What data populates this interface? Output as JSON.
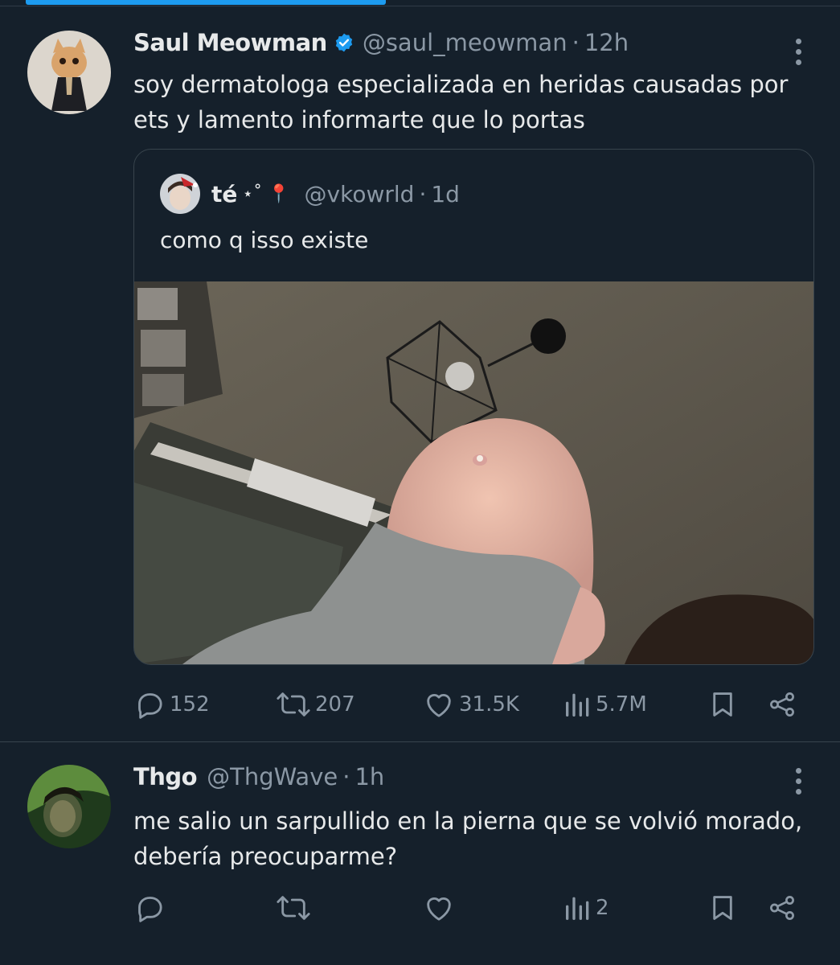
{
  "tweet": {
    "author_name": "Saul Meowman",
    "handle": "@saul_meowman",
    "separator": "·",
    "time": "12h",
    "text_lines": [
      "soy dermatologa especializada en heridas causadas por",
      "ets y lamento informarte que lo portas"
    ],
    "quoted": {
      "author_name": "té",
      "name_decoration": "⋆˚ 📍",
      "handle": "@vkowrld",
      "separator": "·",
      "time": "1d",
      "text": "como q isso existe"
    },
    "replies": "152",
    "reposts": "207",
    "likes": "31.5K",
    "views": "5.7M"
  },
  "reply": {
    "author_name": "Thgo",
    "handle": "@ThgWave",
    "separator": "·",
    "time": "1h",
    "text_lines": [
      "me salio un sarpullido en la pierna que se volvió morado,",
      "debería preocuparme?"
    ],
    "views": "2"
  },
  "colors": {
    "background": "#15202b",
    "accent": "#1d9bf0",
    "text_primary": "#e7e9ea",
    "text_secondary": "#8b98a5",
    "border": "#38444d"
  },
  "icons": [
    "reply-icon",
    "repost-icon",
    "like-icon",
    "views-icon",
    "bookmark-icon",
    "share-icon",
    "more-icon",
    "verified-badge-icon"
  ]
}
